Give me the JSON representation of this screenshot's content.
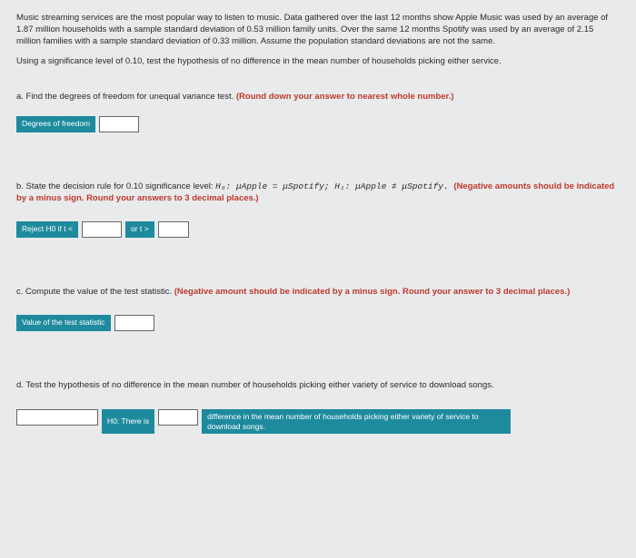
{
  "intro": {
    "p1": "Music streaming services are the most popular way to listen to music. Data gathered over the last 12 months show Apple Music was used by an average of 1.87 million households with a sample standard deviation of 0.53 million family units. Over the same 12 months Spotify was used by an average of 2.15 million families with a sample standard deviation of 0.33 million. Assume the population standard deviations are not the same.",
    "p2": "Using a significance level of 0.10, test the hypothesis of no difference in the mean number of households picking either service."
  },
  "a": {
    "prompt": "a.  Find the degrees of freedom for unequal variance test. ",
    "note": "(Round down your answer to nearest whole number.)",
    "label": "Degrees of freedom"
  },
  "b": {
    "prompt_pre": "b.  State the decision rule for 0.10 significance level: ",
    "h0": "H₀: μApple = μSpotify; ",
    "h1": "H₁: μApple ≠ μSpotify. ",
    "note": "(Negative amounts should be indicated by a minus sign. Round your answers to 3 decimal places.)",
    "label_left": "Reject H0 if t <",
    "label_mid": "or t >"
  },
  "c": {
    "prompt": "c.  Compute the value of the test statistic. ",
    "note": "(Negative amount should be indicated by a minus sign. Round your answer to 3 decimal places.)",
    "label": "Value of the test statistic"
  },
  "d": {
    "prompt": "d.  Test the hypothesis of no difference in the mean number of households picking either variety of service to download songs.",
    "label_left": "H0: There is",
    "label_right": "difference in the mean number of households picking either variety of service to download songs."
  }
}
